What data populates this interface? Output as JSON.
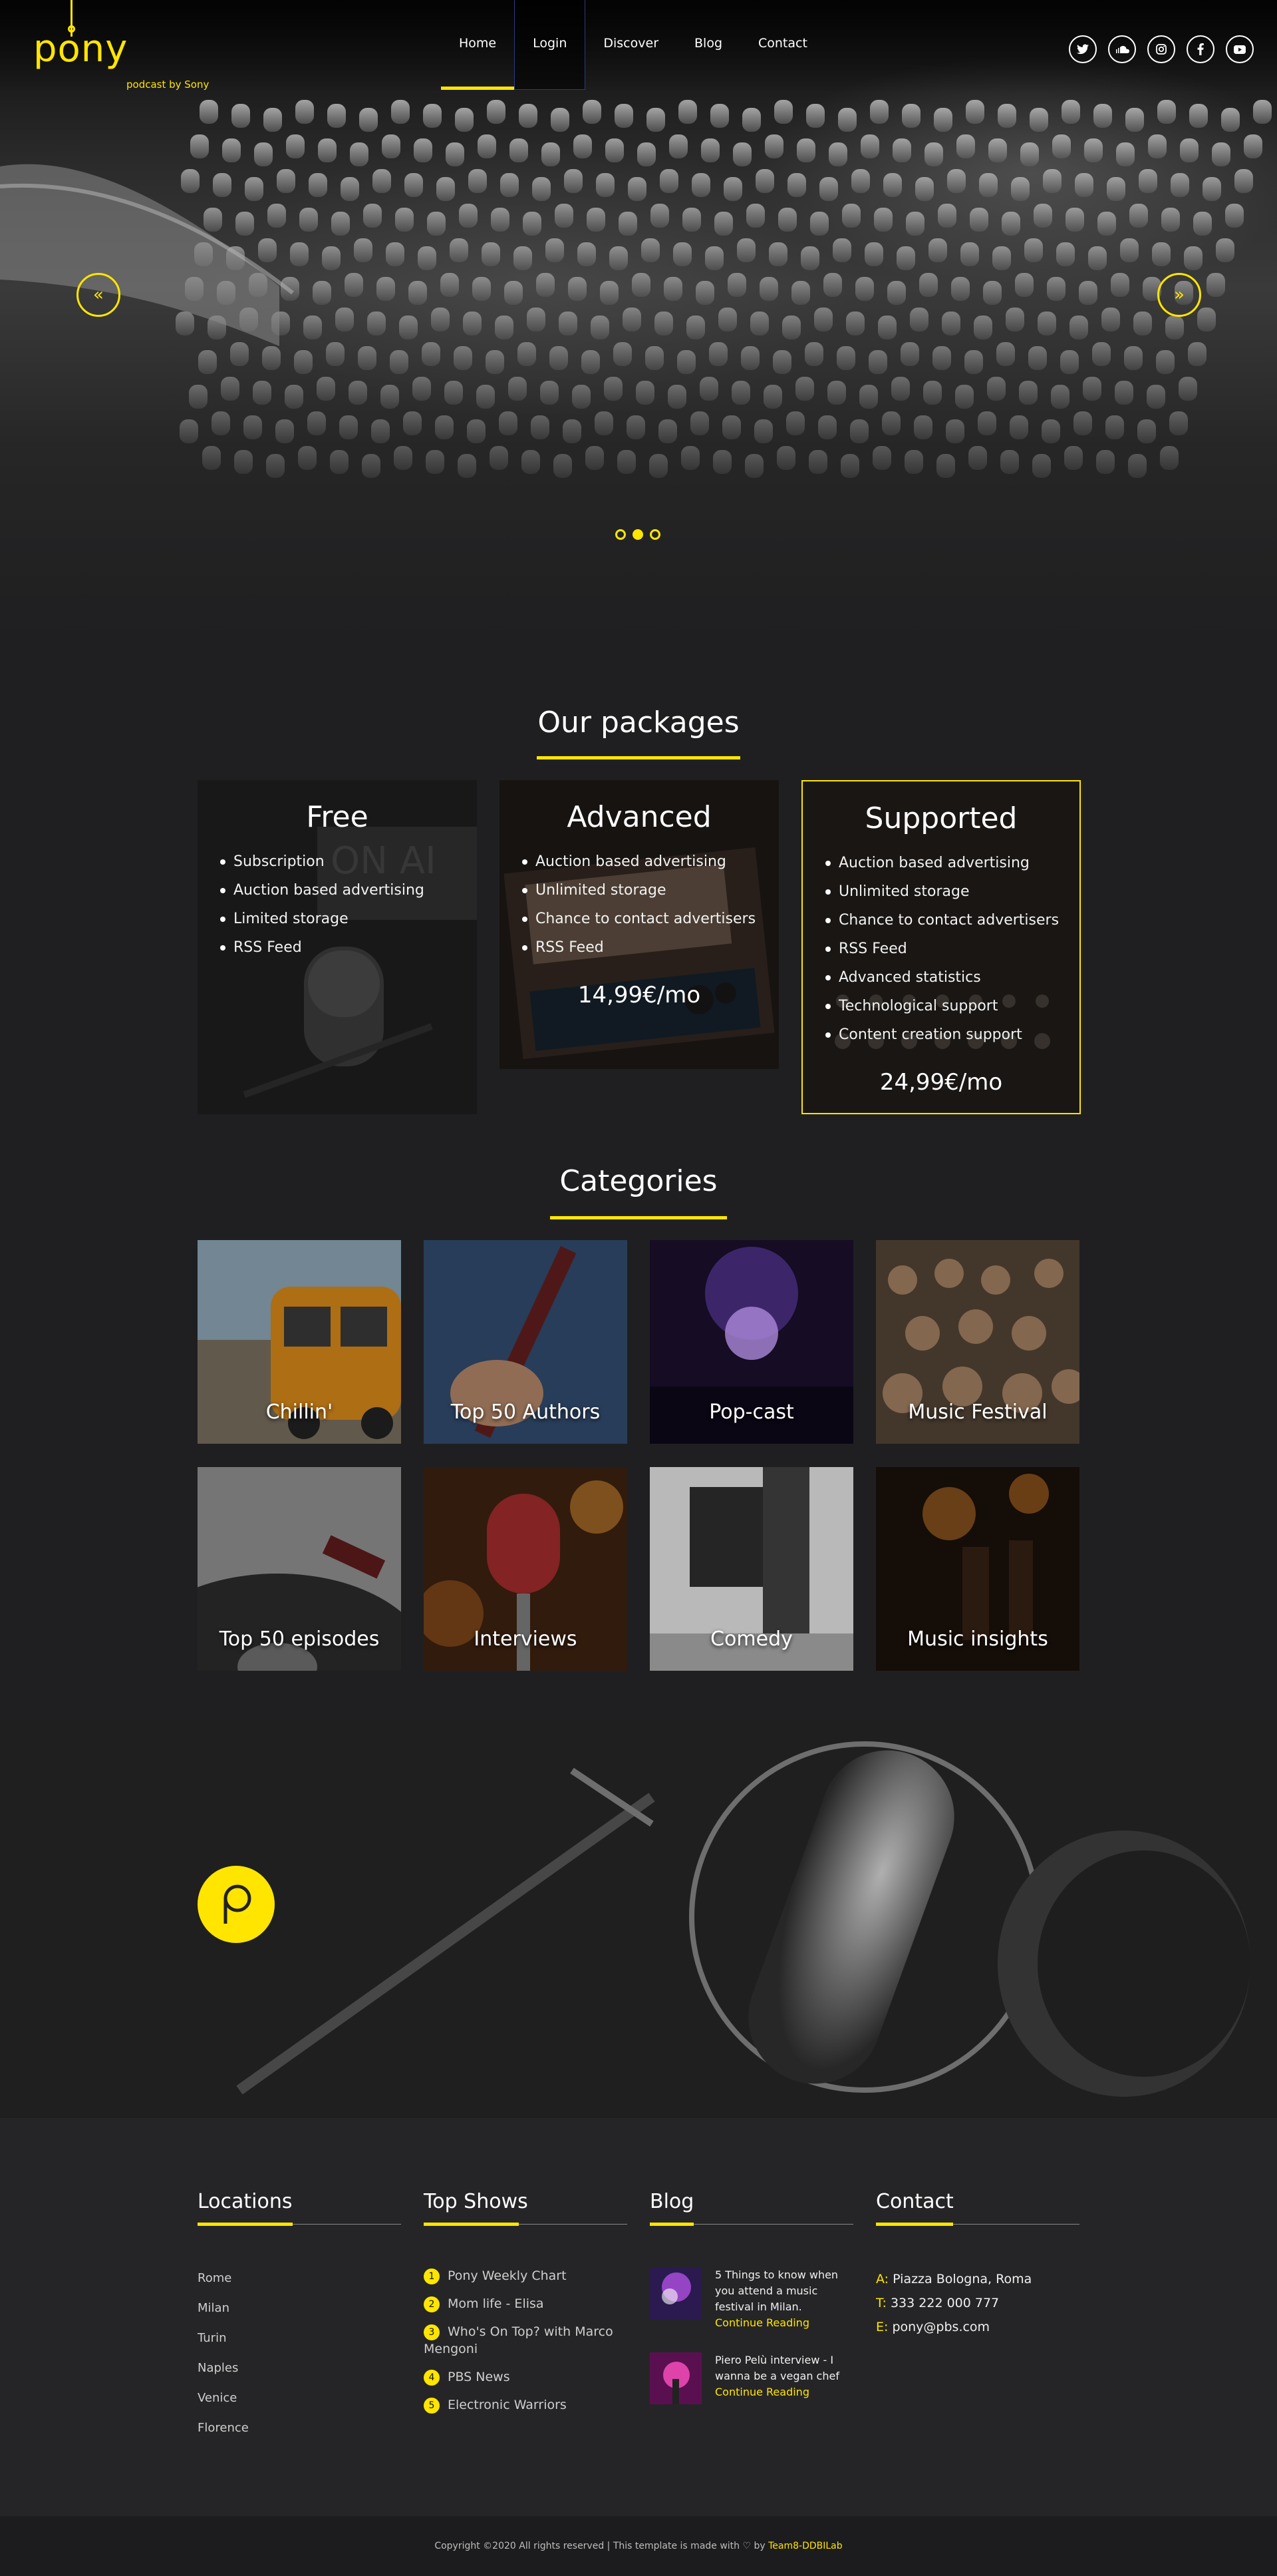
{
  "brand": {
    "logo": "pony",
    "tagline": "podcast by Sony"
  },
  "nav": [
    "Home",
    "Login",
    "Discover",
    "Blog",
    "Contact"
  ],
  "social_icons": [
    "twitter-icon",
    "soundcloud-icon",
    "instagram-icon",
    "facebook-icon",
    "youtube-icon"
  ],
  "hero": {
    "prev": "«",
    "next": "»",
    "slides": 3,
    "active_slide": 2
  },
  "packages": {
    "title": "Our packages",
    "items": [
      {
        "name": "Free",
        "features": [
          "Subscription",
          "Auction based advertising",
          "Limited storage",
          "RSS Feed"
        ],
        "price": ""
      },
      {
        "name": "Advanced",
        "features": [
          "Auction based advertising",
          "Unlimited storage",
          "Chance to contact advertisers",
          "RSS Feed"
        ],
        "price": "14,99€/mo"
      },
      {
        "name": "Supported",
        "features": [
          "Auction based advertising",
          "Unlimited storage",
          "Chance to contact advertisers",
          "RSS Feed",
          "Advanced statistics",
          "Technological support",
          "Content creation support"
        ],
        "price": "24,99€/mo"
      }
    ]
  },
  "categories": {
    "title": "Categories",
    "items": [
      "Chillin'",
      "Top 50 Authors",
      "Pop-cast",
      "Music Festival",
      "Top 50 episodes",
      "Interviews",
      "Comedy",
      "Music insights"
    ]
  },
  "footer": {
    "locations": {
      "title": "Locations",
      "items": [
        "Rome",
        "Milan",
        "Turin",
        "Naples",
        "Venice",
        "Florence"
      ]
    },
    "top_shows": {
      "title": "Top Shows",
      "items": [
        "Pony Weekly Chart",
        "Mom life - Elisa",
        "Who's On Top? with Marco Mengoni",
        "PBS News",
        "Electronic Warriors"
      ]
    },
    "blog": {
      "title": "Blog",
      "posts": [
        {
          "text": "5 Things to know when you attend a music festival in Milan.",
          "link": "Continue Reading"
        },
        {
          "text": "Piero Pelù interview - I wanna be a vegan chef",
          "link": "Continue Reading"
        }
      ]
    },
    "contact": {
      "title": "Contact",
      "address_key": "A:",
      "address": "Piazza Bologna, Roma",
      "phone_key": "T:",
      "phone": "333 222 000 777",
      "email_key": "E:",
      "email": "pony@pbs.com"
    }
  },
  "copyright": {
    "text": "Copyright ©2020 All rights reserved | This template is made with ♡ by",
    "author": "Team8-DDBILab"
  },
  "colors": {
    "accent": "#ffe500",
    "background": "#1f1f21",
    "footer": "#252527"
  }
}
